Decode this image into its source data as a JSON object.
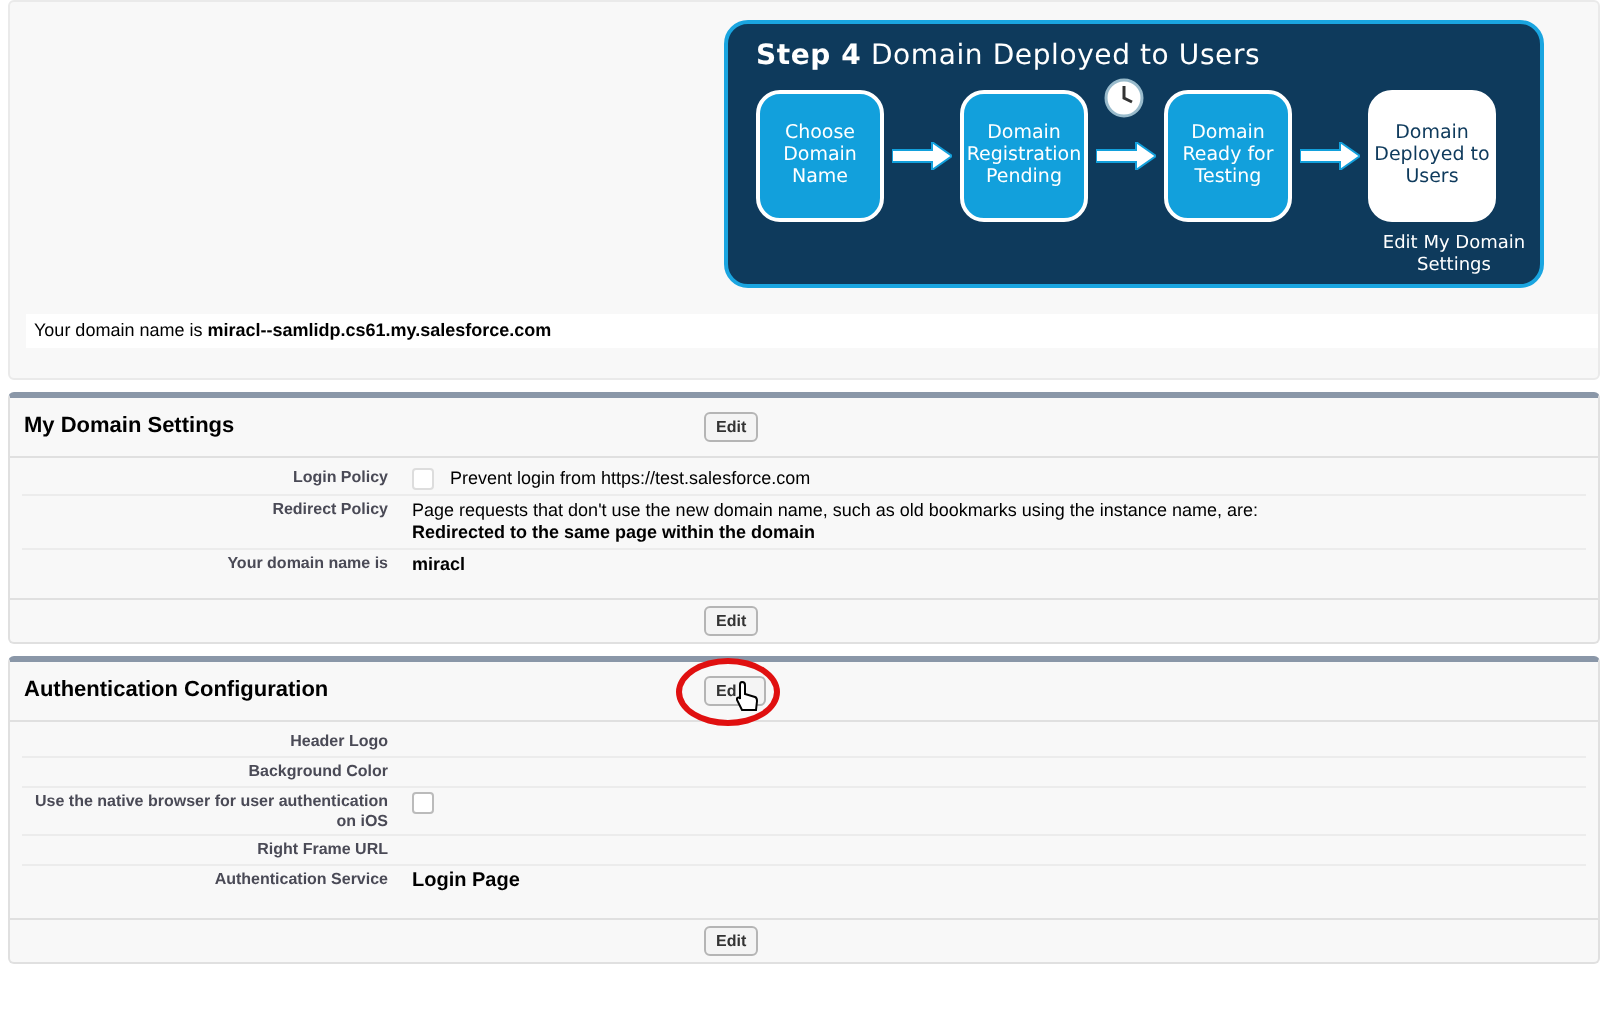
{
  "banner": {
    "title": "**Step 4** Domain Deployed to Users",
    "steps": [
      {
        "label": "Choose Domain Name",
        "current": false
      },
      {
        "label": "Domain Registration Pending",
        "current": false
      },
      {
        "label": "Domain Ready for Testing",
        "current": false
      },
      {
        "label": "Domain Deployed to Users",
        "current": true
      }
    ],
    "caption": "Edit My Domain Settings"
  },
  "domain_line": "Your domain name is **miracl--samlidp.cs61.my.salesforce.com**",
  "sections": [
    {
      "title": "My Domain Settings",
      "edit_top": "Edit",
      "highlighted": false,
      "edit_bottom": "Edit",
      "fields": [
        {
          "label": "Login Policy",
          "kind": "checkbox",
          "checked": false,
          "disabled": true,
          "text": "Prevent login from https://test.salesforce.com"
        },
        {
          "label": "Redirect Policy",
          "kind": "text",
          "value": "Page requests that don't use the new domain name, such as old bookmarks using the instance name, are:",
          "note": "Redirected to the same page within the domain"
        },
        {
          "label": "Your domain name is",
          "kind": "text",
          "value": "miracl",
          "bold": true
        }
      ]
    },
    {
      "title": "Authentication Configuration",
      "edit_top": "Ed",
      "highlighted": true,
      "edit_bottom": "Edit",
      "fields": [
        {
          "label": "Header Logo",
          "kind": "text"
        },
        {
          "label": "Background Color",
          "kind": "text"
        },
        {
          "label": "Use the native browser for user authentication on iOS",
          "kind": "checkbox",
          "checked": false,
          "disabled": false
        },
        {
          "label": "Right Frame URL",
          "kind": "text"
        },
        {
          "label": "Authentication Service",
          "kind": "text",
          "value": "Login Page",
          "bold": true,
          "large": true
        }
      ]
    }
  ]
}
